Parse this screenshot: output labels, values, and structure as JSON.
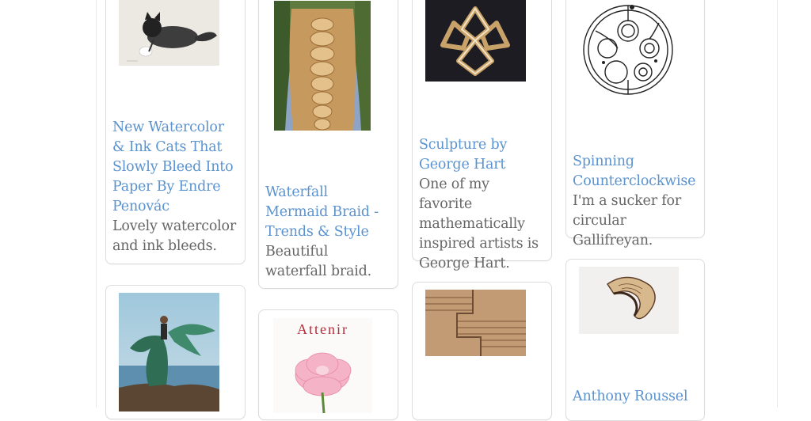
{
  "pins": [
    {
      "title": "New Watercolor & Ink Cats That Slowly Bleed Into Paper By Endre Penovác",
      "description": "Lovely watercolor and ink bleeds.",
      "image": "watercolor-cat-image"
    },
    {
      "title": "Waterfall Mermaid Braid - Trends & Style",
      "description": "Beautiful waterfall braid.",
      "image": "braided-hair-image"
    },
    {
      "title": "Sculpture by George Hart",
      "description": "One of my favorite mathematically inspired artists is George Hart.",
      "image": "geometric-sculpture-image"
    },
    {
      "title": "Spinning Counterclockwise",
      "description": "I'm a sucker for circular Gallifreyan.",
      "image": "gallifreyan-circle-image"
    },
    {
      "title": "",
      "description": "",
      "image": "woman-flowing-dress-image"
    },
    {
      "title": "",
      "description": "",
      "image": "attenir-peony-image",
      "image_text": "Attenir"
    },
    {
      "title": "",
      "description": "",
      "image": "wood-veneer-image"
    },
    {
      "title": "Anthony Roussel",
      "description": "",
      "image": "spiral-wood-sculpture-image"
    }
  ],
  "colors": {
    "link": "#5b93cf",
    "text": "#666666",
    "card_border": "#dcdcdc"
  }
}
